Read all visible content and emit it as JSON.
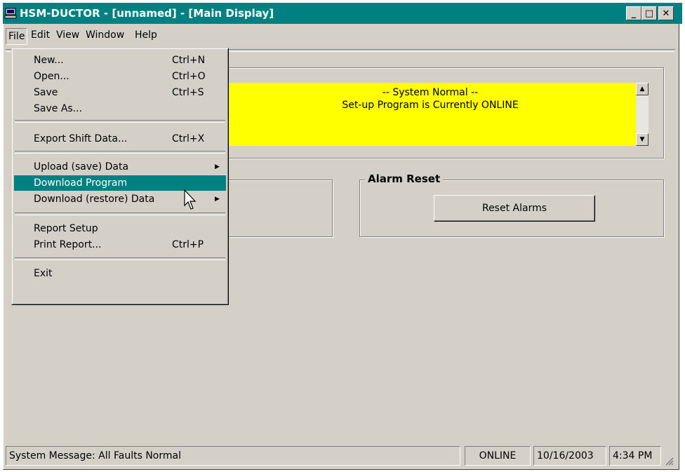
{
  "window": {
    "title": "HSM-DUCTOR - [unnamed] - [Main Display]"
  },
  "title_buttons": {
    "minimize": "_",
    "maximize": "□",
    "close": "✕"
  },
  "menubar": [
    {
      "label": "File",
      "id": "file"
    },
    {
      "label": "Edit",
      "id": "edit"
    },
    {
      "label": "View",
      "id": "view"
    },
    {
      "label": "Window",
      "id": "window"
    },
    {
      "label": "Help",
      "id": "help"
    }
  ],
  "file_menu": {
    "items": [
      {
        "label": "New...",
        "shortcut": "Ctrl+N"
      },
      {
        "label": "Open...",
        "shortcut": "Ctrl+O"
      },
      {
        "label": "Save",
        "shortcut": "Ctrl+S"
      },
      {
        "label": "Save As...",
        "shortcut": ""
      },
      {
        "label": "Export Shift Data...",
        "shortcut": "Ctrl+X"
      },
      {
        "label": "Upload (save) Data",
        "shortcut": ""
      },
      {
        "label": "Download Program",
        "shortcut": ""
      },
      {
        "label": "Download (restore) Data",
        "shortcut": ""
      },
      {
        "label": "Report Setup",
        "shortcut": ""
      },
      {
        "label": "Print Report...",
        "shortcut": "Ctrl+P"
      },
      {
        "label": "Exit",
        "shortcut": ""
      }
    ],
    "highlighted": "Download Program"
  },
  "system_message_box": {
    "line1": "-- System Normal --",
    "line2": "Set-up Program is Currently ONLINE",
    "background": "#ffff00"
  },
  "alarm_reset": {
    "title": "Alarm Reset",
    "button_label": "Reset Alarms"
  },
  "statusbar": {
    "message": "System Message:  All Faults Normal",
    "mode": "ONLINE",
    "date": "10/16/2003",
    "time": "4:34 PM"
  },
  "colors": {
    "titlebar": "#008080",
    "highlight": "#008080",
    "chrome": "#d4d0c8"
  }
}
